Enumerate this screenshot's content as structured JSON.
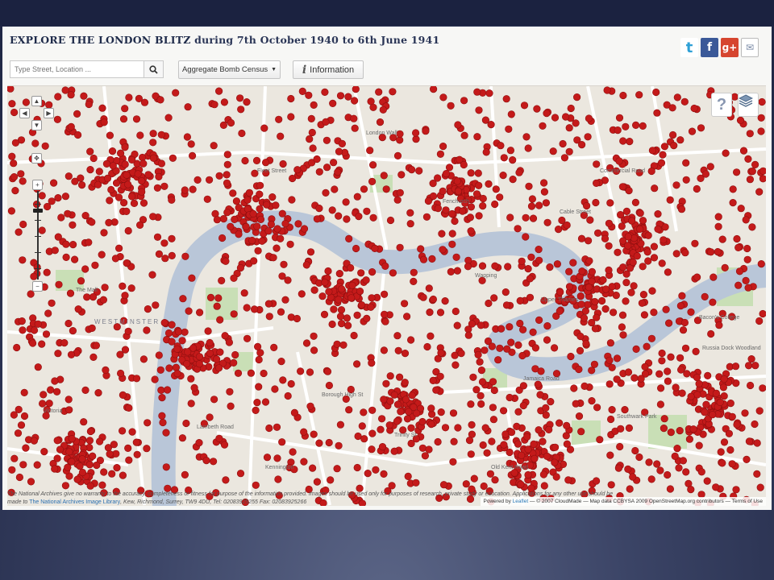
{
  "header": {
    "title_main": "EXPLORE THE LONDON BLITZ",
    "title_sub": "during 7th October 1940 to 6th June 1941"
  },
  "toolbar": {
    "search_placeholder": "Type Street, Location ...",
    "census_label": "Aggregate Bomb Census",
    "info_label": "Information"
  },
  "social": {
    "twitter": "t",
    "facebook": "f",
    "googleplus": "g+",
    "share": "✉"
  },
  "map": {
    "district_label": "WESTMINSTER",
    "street_labels": [
      "Fleet Street",
      "London Wall",
      "Upper Thames",
      "Cable Street",
      "Commercial Road",
      "The Mall",
      "Borough High St",
      "Jamaica Road",
      "Bacon's College",
      "Russia Dock Woodland",
      "Southwark Park",
      "Trinity St",
      "Lambeth Road",
      "Old Kent Road",
      "Kennington",
      "Fenchurch",
      "Wapping",
      "Victoria"
    ],
    "bomb_color": "#c41a1a",
    "river_color": "#b9c6d8",
    "park_color": "#c9dfb6",
    "attribution": {
      "powered": "Powered by",
      "leaflet": "Leaflet",
      "rest": "— © 2007 CloudMade — Map data CCBYSA 2009 OpenStreetMap.org contributors — Terms of Use"
    }
  },
  "footer": {
    "disclaimer_1": "The National Archives give no warranty to the accuracy, completeness or fitness for purpose of the information provided. Images should be used only for purposes of research, private study or education. Applications for any other use should be",
    "disclaimer_2a": "made to",
    "disclaimer_link": "The National Archives Image Library",
    "disclaimer_2b": ", Kew, Richmond, Surrey, TW9 4DU, Tel: 02083925255 Fax: 02083925266"
  }
}
